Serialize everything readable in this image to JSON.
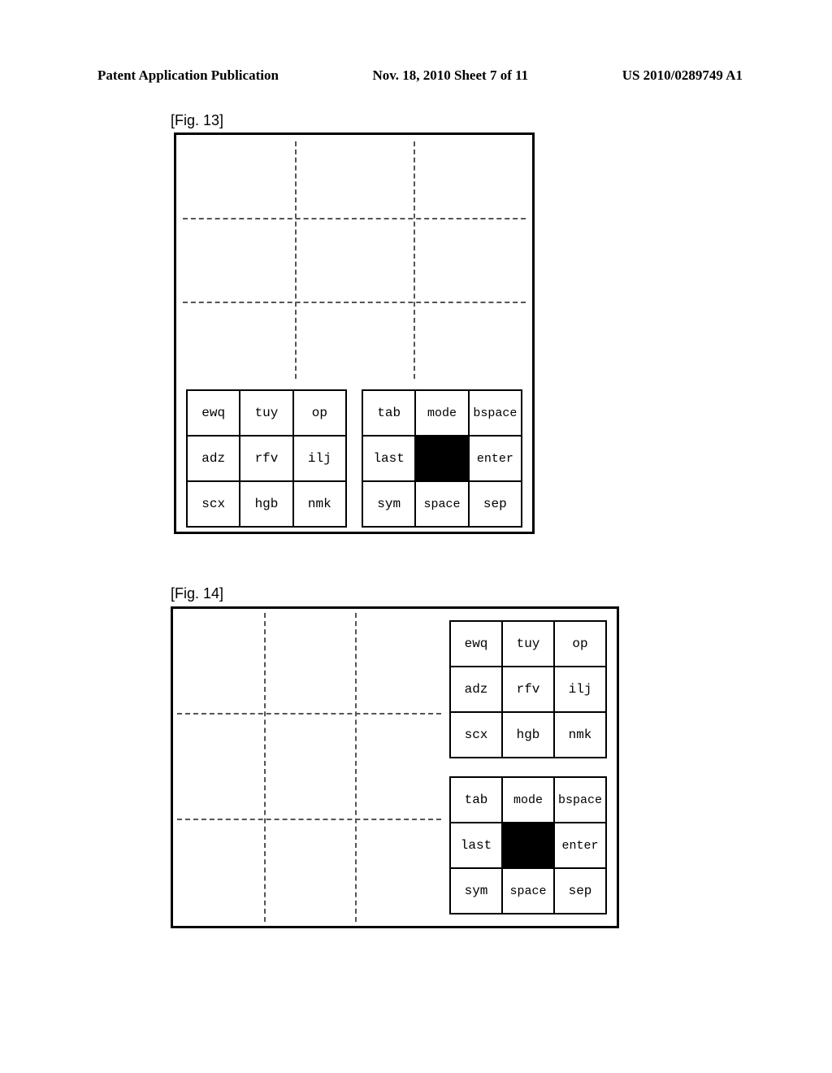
{
  "header": {
    "left": "Patent Application Publication",
    "mid": "Nov. 18, 2010  Sheet 7 of 11",
    "right": "US 2010/0289749 A1"
  },
  "fig13": {
    "label": "[Fig. 13]",
    "left_keys": {
      "r0c0": "ewq",
      "r0c1": "tuy",
      "r0c2": "op",
      "r1c0": "adz",
      "r1c1": "rfv",
      "r1c2": "ilj",
      "r2c0": "scx",
      "r2c1": "hgb",
      "r2c2": "nmk"
    },
    "right_keys": {
      "r0c0": "tab",
      "r0c1": "mode",
      "r0c2": "bspace",
      "r1c0": "last",
      "r1c1": "",
      "r1c2": "enter",
      "r2c0": "sym",
      "r2c1": "space",
      "r2c2": "sep"
    }
  },
  "fig14": {
    "label": "[Fig. 14]",
    "top_keys": {
      "r0c0": "ewq",
      "r0c1": "tuy",
      "r0c2": "op",
      "r1c0": "adz",
      "r1c1": "rfv",
      "r1c2": "ilj",
      "r2c0": "scx",
      "r2c1": "hgb",
      "r2c2": "nmk"
    },
    "bot_keys": {
      "r0c0": "tab",
      "r0c1": "mode",
      "r0c2": "bspace",
      "r1c0": "last",
      "r1c1": "",
      "r1c2": "enter",
      "r2c0": "sym",
      "r2c1": "space",
      "r2c2": "sep"
    }
  }
}
